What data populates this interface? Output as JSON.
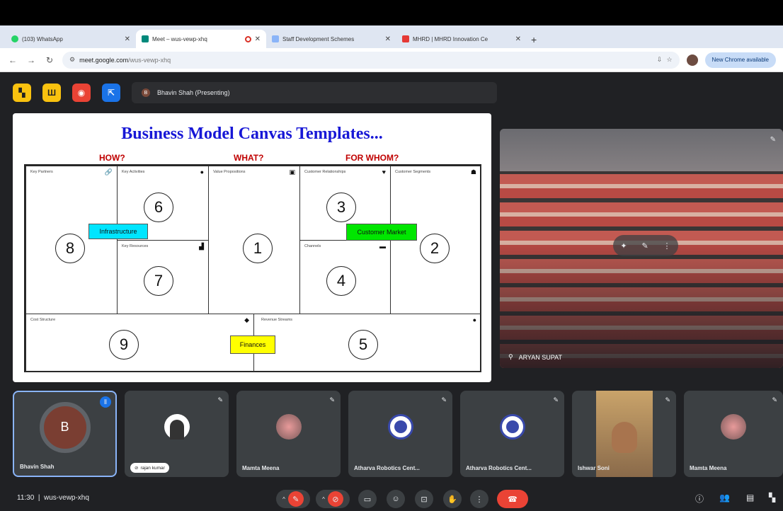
{
  "browser": {
    "tabs": [
      {
        "title": "(103) WhatsApp",
        "fav_color": "#25d366"
      },
      {
        "title": "Meet – wus-vewp-xhq",
        "fav_color": "#00897b"
      },
      {
        "title": "Staff Development Schemes",
        "fav_color": "#8ab4f8"
      },
      {
        "title": "MHRD | MHRD Innovation Ce",
        "fav_color": "#e53935"
      }
    ],
    "url_host": "meet.google.com",
    "url_path": "/wus-vewp-xhq",
    "new_chrome": "New Chrome available"
  },
  "meet": {
    "presenting": "Bhavin Shah (Presenting)",
    "presenter_initial": "B",
    "slide": {
      "title": "Business Model Canvas Templates...",
      "headers": {
        "how": "HOW?",
        "what": "WHAT?",
        "for_whom": "FOR WHOM?"
      },
      "cells": {
        "key_partners": "Key Partners",
        "key_activities": "Key Activities",
        "value_propositions": "Value Propositions",
        "customer_relationships": "Customer Relationships",
        "customer_segments": "Customer Segments",
        "key_resources": "Key Resources",
        "channels": "Channels",
        "cost_structure": "Cost Structure",
        "revenue_streams": "Revenue Streams"
      },
      "numbers": [
        "1",
        "2",
        "3",
        "4",
        "5",
        "6",
        "7",
        "8",
        "9"
      ],
      "tags": {
        "infrastructure": "Infrastructure",
        "customer_market": "Customer Market",
        "finances": "Finances"
      }
    },
    "camera_name": "ARYAN SUPAT",
    "participants": [
      {
        "name": "Bhavin Shah",
        "initial": "B"
      },
      {
        "name": "rajan kumar"
      },
      {
        "name": "Mamta Meena"
      },
      {
        "name": "Atharva Robotics Cent..."
      },
      {
        "name": "Atharva Robotics Cent..."
      },
      {
        "name": "Ishwar Soni"
      },
      {
        "name": "Mamta Meena"
      }
    ],
    "clock": "11:30",
    "meeting_code": "wus-vewp-xhq"
  },
  "colors": {
    "title_blue": "#1717d6",
    "header_red": "#c00000",
    "tag_cyan": "#00e5ff",
    "tag_green": "#00e600",
    "tag_yellow": "#ffff00",
    "end_call": "#ea4335"
  }
}
